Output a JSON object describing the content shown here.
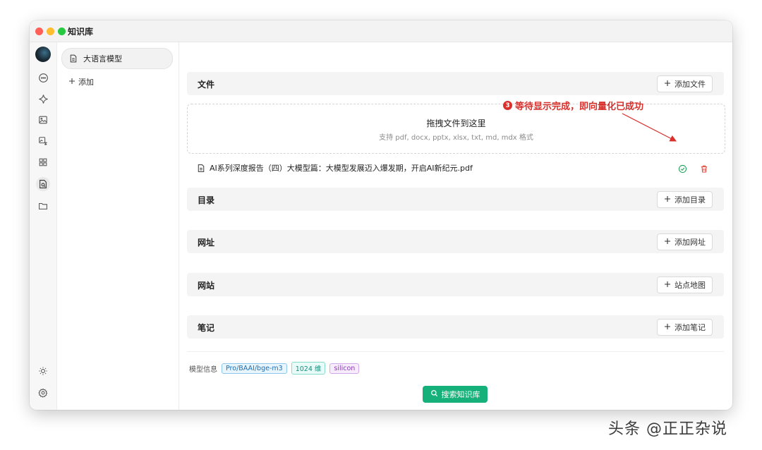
{
  "window": {
    "title": "知识库"
  },
  "sidebar": {
    "knowledge_base": "大语言模型",
    "add_label": "添加"
  },
  "sections": {
    "files": {
      "title": "文件",
      "button": "添加文件"
    },
    "directory": {
      "title": "目录",
      "button": "添加目录"
    },
    "url": {
      "title": "网址",
      "button": "添加网址"
    },
    "website": {
      "title": "网站",
      "button": "站点地图"
    },
    "notes": {
      "title": "笔记",
      "button": "添加笔记"
    }
  },
  "dropzone": {
    "title": "拖拽文件到这里",
    "subtitle": "支持 pdf, docx, pptx, xlsx, txt, md, mdx 格式"
  },
  "file_item": {
    "name": "AI系列深度报告（四）大模型篇：大模型发展迈入爆发期，开启AI新纪元.pdf",
    "status": "completed"
  },
  "model_info": {
    "label": "模型信息",
    "tags": [
      "Pro/BAAI/bge-m3",
      "1024 维",
      "silicon"
    ]
  },
  "search_button": "搜索知识库",
  "annotation": {
    "number": "3",
    "text": "等待显示完成，即向量化已成功"
  },
  "watermark": "头条 @正正杂说",
  "colors": {
    "accent_green": "#16b07a",
    "annotation_red": "#d9302c",
    "delete_red": "#e0453a"
  }
}
